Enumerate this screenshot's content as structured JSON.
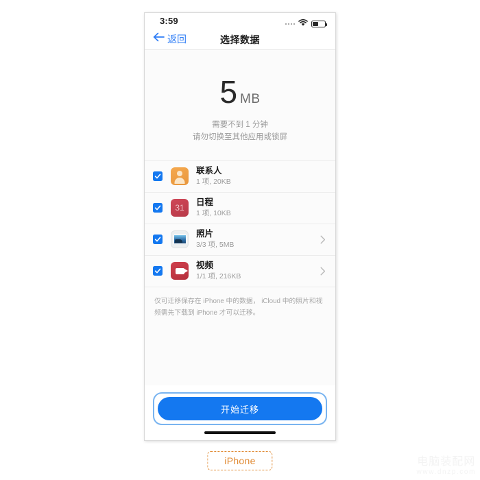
{
  "device": {
    "caption": "iPhone"
  },
  "status_bar": {
    "time": "3:59",
    "signal_icon": "signal-dots-icon",
    "wifi_icon": "wifi-icon",
    "battery_icon": "battery-icon",
    "battery_level_percent": 48
  },
  "nav": {
    "back_icon": "back-arrow-icon",
    "back_label": "返回",
    "title": "选择数据"
  },
  "summary": {
    "size_value": "5",
    "size_unit": "MB",
    "note_line1": "需要不到 1 分钟",
    "note_line2": "请勿切换至其他应用或锁屏"
  },
  "list": {
    "items": [
      {
        "title": "联系人",
        "subtitle": "1 项, 20KB",
        "icon": "contacts-icon",
        "checked": true,
        "has_chevron": false,
        "icon_color": "#ec9a3e"
      },
      {
        "title": "日程",
        "subtitle": "1 项, 10KB",
        "icon": "calendar-icon",
        "icon_text": "31",
        "checked": true,
        "has_chevron": false,
        "icon_color": "#c33f4e"
      },
      {
        "title": "照片",
        "subtitle": "3/3 项, 5MB",
        "icon": "photos-icon",
        "checked": true,
        "has_chevron": true,
        "icon_color": "#eceff0"
      },
      {
        "title": "视频",
        "subtitle": "1/1 项, 216KB",
        "icon": "video-icon",
        "checked": true,
        "has_chevron": true,
        "icon_color": "#c3363f"
      }
    ]
  },
  "footnote": {
    "text": "仅可迁移保存在 iPhone 中的数据， iCloud 中的照片和视频需先下载到 iPhone 才可以迁移。"
  },
  "actions": {
    "primary_label": "开始迁移",
    "primary_color": "#1478f0",
    "focus_ring_color": "#79b4f0"
  },
  "watermark": {
    "brand": "电脑装配网",
    "url": "www.dnzp.com"
  },
  "theme": {
    "accent": "#1478f0",
    "link": "#2e7df6",
    "caption_orange": "#e08a33",
    "screen_bg": "#fbfbfb"
  }
}
